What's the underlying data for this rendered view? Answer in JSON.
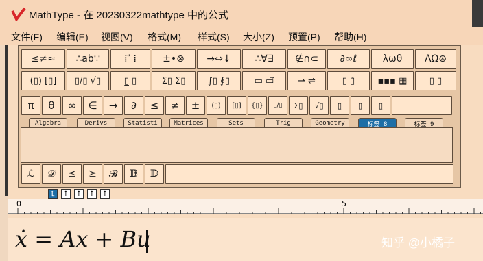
{
  "window": {
    "title": "MathType - 在 20230322mathtype 中的公式",
    "logo_icon": "mathtype-logo-icon"
  },
  "menu": [
    "文件(F)",
    "编辑(E)",
    "视图(V)",
    "格式(M)",
    "样式(S)",
    "大小(Z)",
    "预置(P)",
    "帮助(H)"
  ],
  "palette": {
    "row1": [
      "≤≠≈",
      "∴ab∵",
      "⁞ ⃗ ⁞",
      "±•⊗",
      "→⇔↓",
      "∴∀∃",
      "∉∩⊂",
      "∂∞ℓ",
      "λωθ",
      "ΛΩ⊛"
    ],
    "row2": [
      "(▯) [▯]",
      "▯/▯ √▯",
      "▯̲ ▯̄",
      "Σ▯ Σ▯",
      "∫▯ ∮▯",
      "▭ ▭⃗",
      "⇀ ⇌",
      "▯̄ ▯̇",
      "▪▪▪ ▦",
      "▯ ▯"
    ],
    "row3": [
      "π",
      "θ",
      "∞",
      "∈",
      "→",
      "∂",
      "≤",
      "≠",
      "±",
      "(▯)",
      "[▯]",
      "{▯}",
      "▯/▯",
      "Σ▯",
      "√▯",
      "▯̲",
      "▯̄",
      "▯̲̄"
    ],
    "tabs": [
      "Algebra",
      "Derivs",
      "Statisti",
      "Matrices",
      "Sets",
      "Trig",
      "Geometry",
      "标签 8",
      "标签 9"
    ],
    "active_tab": "标签 8",
    "row5": [
      "ℒ",
      "𝒟",
      "⪯",
      "⪰",
      "𝓑",
      "𝔹",
      "𝔻"
    ]
  },
  "alignment_icons": [
    "⮤",
    "↑",
    "↑",
    "↑",
    "↑"
  ],
  "ruler": {
    "mark_0": "0",
    "mark_5": "5"
  },
  "editor": {
    "formula": "ẋ = Ax + Bu"
  },
  "watermark": "知乎 @小橘子"
}
